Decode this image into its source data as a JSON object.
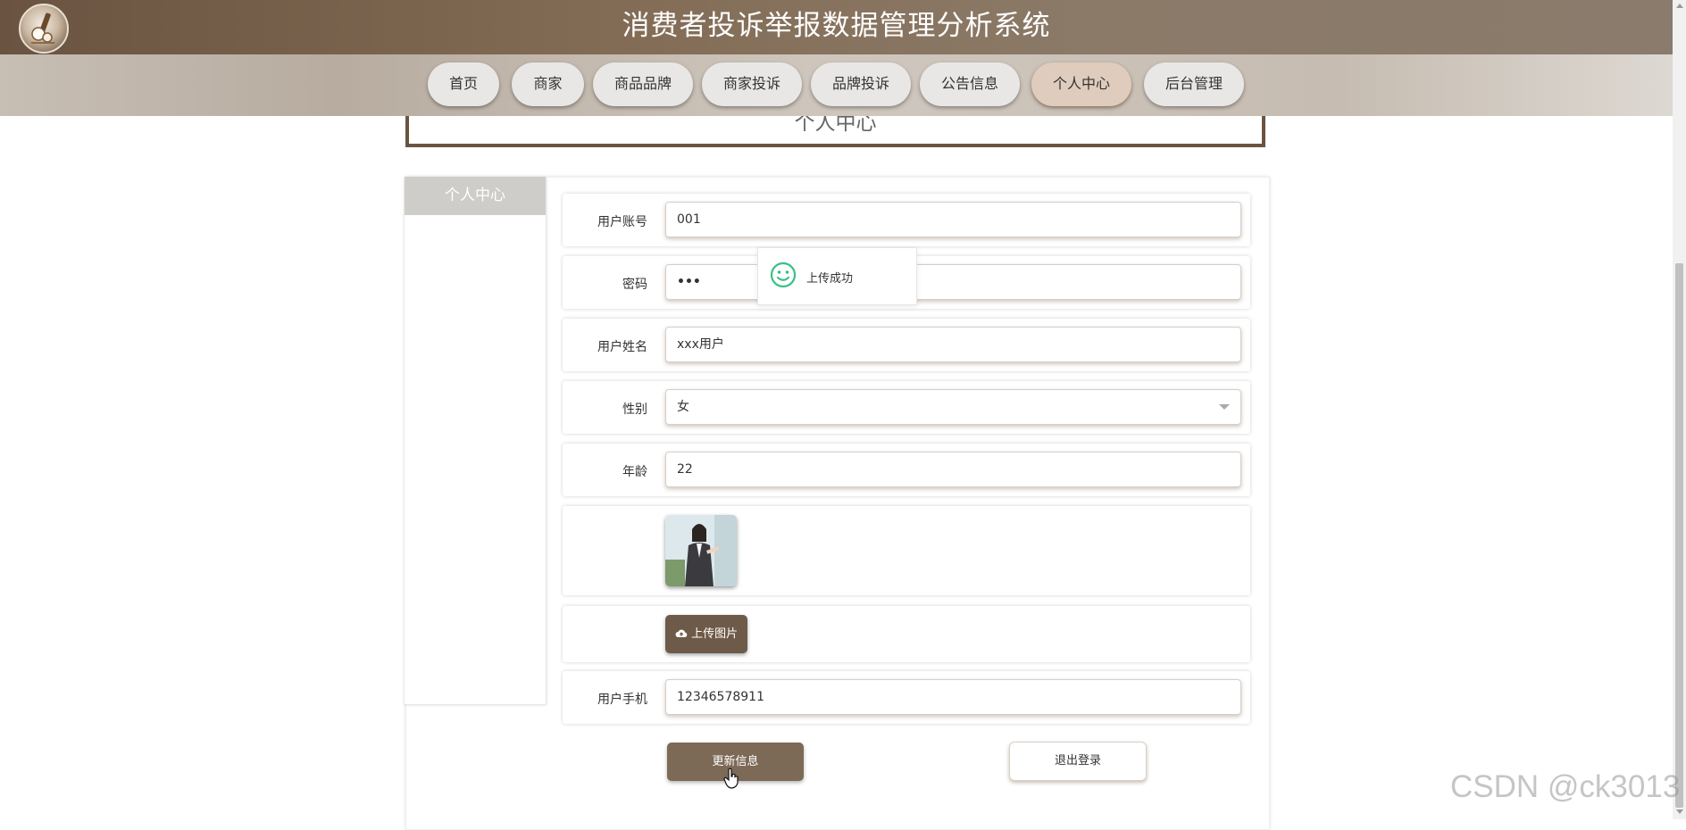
{
  "header": {
    "title": "消费者投诉举报数据管理分析系统",
    "logo": "brand-logo"
  },
  "nav": {
    "items": [
      {
        "label": "首页",
        "active": false
      },
      {
        "label": "商家",
        "active": false
      },
      {
        "label": "商品品牌",
        "active": false
      },
      {
        "label": "商家投诉",
        "active": false
      },
      {
        "label": "品牌投诉",
        "active": false
      },
      {
        "label": "公告信息",
        "active": false
      },
      {
        "label": "个人中心",
        "active": true
      },
      {
        "label": "后台管理",
        "active": false
      }
    ]
  },
  "page": {
    "title": "个人中心"
  },
  "sidebar": {
    "header": "个人中心"
  },
  "form": {
    "account": {
      "label": "用户账号",
      "value": "001"
    },
    "password": {
      "label": "密码",
      "value": "•••"
    },
    "name": {
      "label": "用户姓名",
      "value": "xxx用户"
    },
    "gender": {
      "label": "性别",
      "value": "女"
    },
    "age": {
      "label": "年龄",
      "value": "22"
    },
    "upload_label": "上传图片",
    "phone": {
      "label": "用户手机",
      "value": "12346578911"
    }
  },
  "buttons": {
    "update": "更新信息",
    "logout": "退出登录"
  },
  "toast": {
    "message": "上传成功",
    "icon": "smile-icon"
  },
  "watermark": "CSDN @ck3013",
  "colors": {
    "brand": "#6a5441",
    "nav_active": "#dfccbd",
    "success": "#3cbf87"
  }
}
